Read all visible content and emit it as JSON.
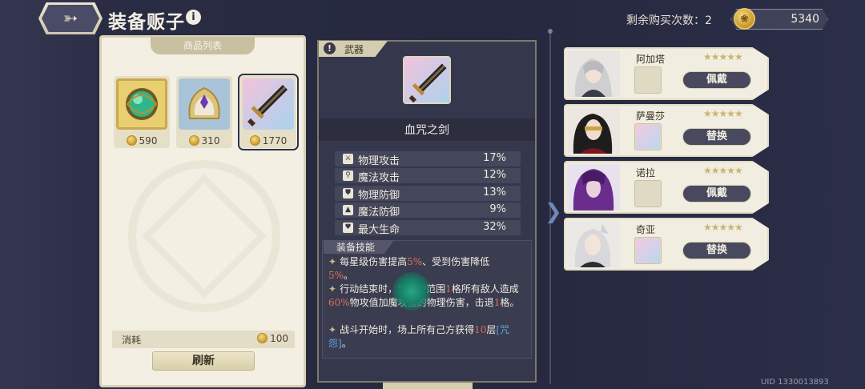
{
  "header": {
    "title": "装备贩子",
    "buy_count_label": "剩余购买次数：2",
    "gold": "5340"
  },
  "shop": {
    "tab_label": "商品列表",
    "items": [
      {
        "name": "green-orb-accessory",
        "price": "590"
      },
      {
        "name": "violet-gem-helmet",
        "price": "310"
      },
      {
        "name": "blood-curse-sword",
        "price": "1770"
      }
    ],
    "cost_label": "消耗",
    "cost_value": "100",
    "refresh_label": "刷新"
  },
  "detail": {
    "category": "武器",
    "name": "血咒之剑",
    "stats": [
      {
        "label": "物理攻击",
        "value": "17%",
        "icon": "sword-icon"
      },
      {
        "label": "魔法攻击",
        "value": "12%",
        "icon": "wand-icon"
      },
      {
        "label": "物理防御",
        "value": "13%",
        "icon": "shield-icon"
      },
      {
        "label": "魔法防御",
        "value": "9%",
        "icon": "hat-icon"
      },
      {
        "label": "最大生命",
        "value": "32%",
        "icon": "heart-icon"
      }
    ],
    "skill_tab": "装备技能",
    "skills": {
      "line1_a": "每星级伤害提高",
      "line1_b": "5%",
      "line1_c": "、受到伤害降低",
      "line1_d": "5%",
      "line1_e": "。",
      "line2_a": "行动结束时，对自身范围",
      "line2_b": "1",
      "line2_c": "格所有敌人造成",
      "line2_d": "60%",
      "line2_e": "物攻值加魔攻值的物理伤害，击退",
      "line2_f": "1",
      "line2_g": "格。",
      "line3_a": "战斗开始时，场上所有己方获得",
      "line3_b": "10",
      "line3_c": "层",
      "line3_d": "[咒怨]",
      "line3_e": "。"
    }
  },
  "characters": [
    {
      "name": "阿加塔",
      "button": "佩戴",
      "stars": "★★★★★",
      "equipped": false
    },
    {
      "name": "萨曼莎",
      "button": "替换",
      "stars": "★★★★★",
      "equipped": true
    },
    {
      "name": "诺拉",
      "button": "佩戴",
      "stars": "★★★★★",
      "equipped": false
    },
    {
      "name": "奇亚",
      "button": "替换",
      "stars": "★★★★★",
      "equipped": true
    }
  ],
  "uid": "UID 1330013893",
  "colors": {
    "accent_gold": "#c8962a",
    "highlight_red": "#e27054",
    "highlight_blue": "#5fa3de"
  }
}
